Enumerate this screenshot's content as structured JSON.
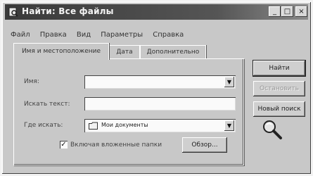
{
  "window": {
    "title": "Найти: Все файлы",
    "controls": [
      "_",
      "□",
      "×"
    ]
  },
  "menubar": {
    "items": [
      "Файл",
      "Правка",
      "Вид",
      "Параметры",
      "Справка"
    ]
  },
  "tabs": [
    {
      "label": "Имя и местоположение",
      "active": true
    },
    {
      "label": "Дата",
      "active": false
    },
    {
      "label": "Дополнительно",
      "active": false
    }
  ],
  "form": {
    "name_label": "Имя:",
    "name_value": "",
    "search_text_label": "Искать текст:",
    "search_text_value": "",
    "look_in_label": "Где искать:",
    "look_in_value": "Мои документы",
    "include_subfolders_label": "Включая вложенные папки",
    "include_subfolders_checked": true,
    "browse_label": "Обзор..."
  },
  "buttons": {
    "find_label": "Найти",
    "stop_label": "Остановить",
    "new_search_label": "Новый поиск"
  },
  "icons": {
    "title": "find-files-icon",
    "look_in": "folder-icon",
    "animation": "magnifier-icon"
  }
}
